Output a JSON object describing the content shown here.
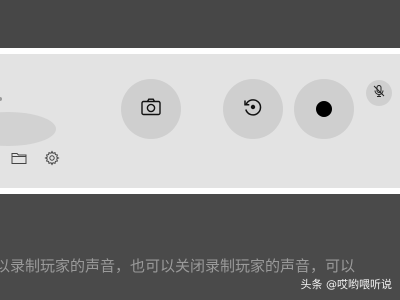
{
  "toolbar": {
    "buttons": [
      {
        "icon": "camera-icon",
        "action": "screenshot"
      },
      {
        "icon": "replay-icon",
        "action": "record-last"
      },
      {
        "icon": "record-icon",
        "action": "start-recording"
      },
      {
        "icon": "mic-off-icon",
        "action": "toggle-mic"
      }
    ],
    "small_icons": [
      "folder-icon",
      "gear-icon"
    ]
  },
  "caption": {
    "text": "可以录制玩家的声音，也可以关闭录制玩家的声音，可以"
  },
  "watermark": {
    "text": "头条 @哎哟喂听说"
  }
}
